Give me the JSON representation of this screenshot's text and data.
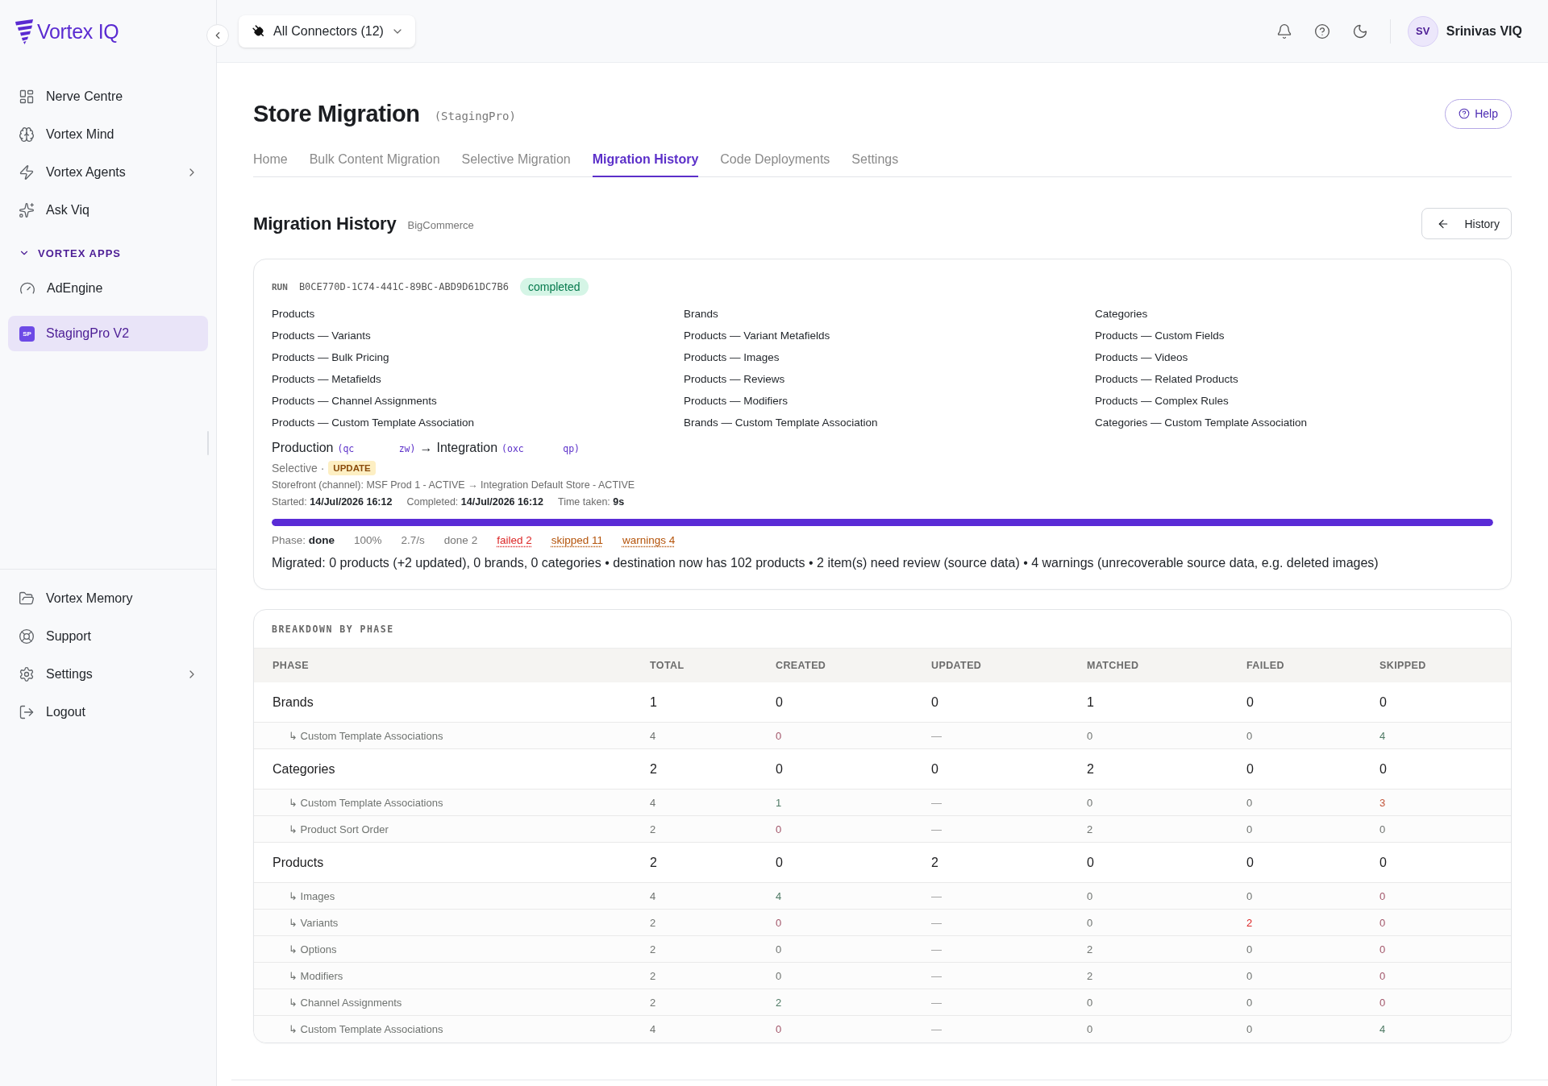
{
  "sidebar": {
    "logo": "Vortex IQ",
    "nav": [
      {
        "label": "Nerve Centre",
        "expandable": false
      },
      {
        "label": "Vortex Mind",
        "expandable": false
      },
      {
        "label": "Vortex Agents",
        "expandable": true
      },
      {
        "label": "Ask Viq",
        "expandable": false
      }
    ],
    "apps_section": {
      "label": "VORTEX APPS",
      "expanded": true
    },
    "apps": [
      {
        "label": "AdEngine",
        "selected": false
      },
      {
        "label": "StagingPro V2",
        "badge": "SP",
        "selected": true
      }
    ],
    "footer": [
      {
        "label": "Vortex Memory",
        "expandable": false
      },
      {
        "label": "Support",
        "expandable": false
      },
      {
        "label": "Settings",
        "expandable": true
      },
      {
        "label": "Logout",
        "expandable": false
      }
    ]
  },
  "header": {
    "connector_select": "All Connectors (12)",
    "user": {
      "initials": "SV",
      "name": "Srinivas VIQ"
    }
  },
  "page": {
    "title": "Store Migration",
    "subtitle": "(StagingPro)",
    "help_button": "Help",
    "tabs": [
      {
        "label": "Home",
        "selected": false
      },
      {
        "label": "Bulk Content Migration",
        "selected": false
      },
      {
        "label": "Selective Migration",
        "selected": false
      },
      {
        "label": "Migration History",
        "selected": true
      },
      {
        "label": "Code Deployments",
        "selected": false
      },
      {
        "label": "Settings",
        "selected": false
      }
    ]
  },
  "section": {
    "title": "Migration History",
    "platform": "BigCommerce",
    "back_button": "History"
  },
  "run": {
    "label": "RUN",
    "id": "B0CE770D-1C74-441C-89BC-ABD9D61DC7B6",
    "status": "completed",
    "scope_columns": [
      [
        "Products",
        "Products — Variants",
        "Products — Bulk Pricing",
        "Products — Metafields",
        "Products — Channel Assignments",
        "Products — Custom Template Association"
      ],
      [
        "Brands",
        "Products — Variant Metafields",
        "Products — Images",
        "Products — Reviews",
        "Products — Modifiers",
        "Brands — Custom Template Association"
      ],
      [
        "Categories",
        "Products — Custom Fields",
        "Products — Videos",
        "Products — Related Products",
        "Products — Complex Rules",
        "Categories — Custom Template Association"
      ]
    ],
    "route": {
      "source": "Production",
      "source_code": "(qc        zw)",
      "arrow": "→",
      "target": "Integration",
      "target_code": "(oxc       qp)"
    },
    "mode": "Selective ·",
    "mode_badge": "UPDATE",
    "storefront": "Storefront (channel): MSF Prod 1 - ACTIVE → Integration Default Store - ACTIVE",
    "times": [
      "Started: **14/Jul/2026 16:12**",
      "Completed: **14/Jul/2026 16:12**",
      "Time taken: **9s**"
    ],
    "progress": {
      "level": 1
    },
    "phase": "Phase: **done**",
    "stats": [
      {
        "text": "100%",
        "kind": "plain"
      },
      {
        "text": "2.7/s",
        "kind": "plain"
      },
      {
        "text": "done 2",
        "kind": "plain"
      },
      {
        "text": "failed 2",
        "kind": "link",
        "color": "#dc2626"
      },
      {
        "text": "skipped 11",
        "kind": "link",
        "color": "#b45309"
      },
      {
        "text": "warnings 4",
        "kind": "link",
        "color": "#b45309"
      }
    ],
    "summary": "Migrated: 0 products (+2 updated), 0 brands, 0 categories • destination now has 102 products • 2 item(s) need review (source data) • 4 warnings (unrecoverable source data, e.g. deleted images)"
  },
  "breakdown": {
    "title": "BREAKDOWN BY PHASE",
    "columns": [
      "PHASE",
      "TOTAL",
      "CREATED",
      "UPDATED",
      "MATCHED",
      "FAILED",
      "SKIPPED"
    ],
    "rows": [
      {
        "phase": "Brands",
        "values": [
          "1",
          "0",
          "0",
          "1",
          "0",
          "0"
        ],
        "children": [
          {
            "phase": "↳ Custom Template Associations",
            "cells": [
              {
                "value": "4",
                "color": "#6f7370"
              },
              {
                "value": "0",
                "color": "#a2566a"
              },
              {
                "value": "—",
                "color": "#9a9a9a"
              },
              {
                "value": "0",
                "color": "#6f7370"
              },
              {
                "value": "0",
                "color": "#6f7370"
              },
              {
                "value": "4",
                "color": "#4f7a65"
              }
            ]
          }
        ]
      },
      {
        "phase": "Categories",
        "values": [
          "2",
          "0",
          "0",
          "2",
          "0",
          "0"
        ],
        "children": [
          {
            "phase": "↳ Custom Template Associations",
            "cells": [
              {
                "value": "4",
                "color": "#6f7370"
              },
              {
                "value": "1",
                "color": "#4f7a65"
              },
              {
                "value": "—",
                "color": "#9a9a9a"
              },
              {
                "value": "0",
                "color": "#6f7370"
              },
              {
                "value": "0",
                "color": "#6f7370"
              },
              {
                "value": "3",
                "color": "#c2553a"
              }
            ]
          },
          {
            "phase": "↳ Product Sort Order",
            "cells": [
              {
                "value": "2",
                "color": "#6f7370"
              },
              {
                "value": "0",
                "color": "#a2566a"
              },
              {
                "value": "—",
                "color": "#9a9a9a"
              },
              {
                "value": "2",
                "color": "#6f7370"
              },
              {
                "value": "0",
                "color": "#6f7370"
              },
              {
                "value": "0",
                "color": "#6f7370"
              }
            ]
          }
        ]
      },
      {
        "phase": "Products",
        "values": [
          "2",
          "0",
          "2",
          "0",
          "0",
          "0"
        ],
        "children": [
          {
            "phase": "↳ Images",
            "cells": [
              {
                "value": "4",
                "color": "#6f7370"
              },
              {
                "value": "4",
                "color": "#4f7a65"
              },
              {
                "value": "—",
                "color": "#9a9a9a"
              },
              {
                "value": "0",
                "color": "#6f7370"
              },
              {
                "value": "0",
                "color": "#6f7370"
              },
              {
                "value": "0",
                "color": "#a2566a"
              }
            ]
          },
          {
            "phase": "↳ Variants",
            "cells": [
              {
                "value": "2",
                "color": "#6f7370"
              },
              {
                "value": "0",
                "color": "#a2566a"
              },
              {
                "value": "—",
                "color": "#9a9a9a"
              },
              {
                "value": "0",
                "color": "#6f7370"
              },
              {
                "value": "2",
                "color": "#dc2626"
              },
              {
                "value": "0",
                "color": "#a2566a"
              }
            ]
          },
          {
            "phase": "↳ Options",
            "cells": [
              {
                "value": "2",
                "color": "#6f7370"
              },
              {
                "value": "0",
                "color": "#6f7370"
              },
              {
                "value": "—",
                "color": "#9a9a9a"
              },
              {
                "value": "2",
                "color": "#6f7370"
              },
              {
                "value": "0",
                "color": "#6f7370"
              },
              {
                "value": "0",
                "color": "#a2566a"
              }
            ]
          },
          {
            "phase": "↳ Modifiers",
            "cells": [
              {
                "value": "2",
                "color": "#6f7370"
              },
              {
                "value": "0",
                "color": "#6f7370"
              },
              {
                "value": "—",
                "color": "#9a9a9a"
              },
              {
                "value": "2",
                "color": "#6f7370"
              },
              {
                "value": "0",
                "color": "#6f7370"
              },
              {
                "value": "0",
                "color": "#a2566a"
              }
            ]
          },
          {
            "phase": "↳ Channel Assignments",
            "cells": [
              {
                "value": "2",
                "color": "#6f7370"
              },
              {
                "value": "2",
                "color": "#4f7a65"
              },
              {
                "value": "—",
                "color": "#9a9a9a"
              },
              {
                "value": "0",
                "color": "#6f7370"
              },
              {
                "value": "0",
                "color": "#6f7370"
              },
              {
                "value": "0",
                "color": "#a2566a"
              }
            ]
          },
          {
            "phase": "↳ Custom Template Associations",
            "cells": [
              {
                "value": "4",
                "color": "#6f7370"
              },
              {
                "value": "0",
                "color": "#a2566a"
              },
              {
                "value": "—",
                "color": "#9a9a9a"
              },
              {
                "value": "0",
                "color": "#6f7370"
              },
              {
                "value": "0",
                "color": "#6f7370"
              },
              {
                "value": "4",
                "color": "#4f7a65"
              }
            ]
          }
        ]
      }
    ]
  }
}
